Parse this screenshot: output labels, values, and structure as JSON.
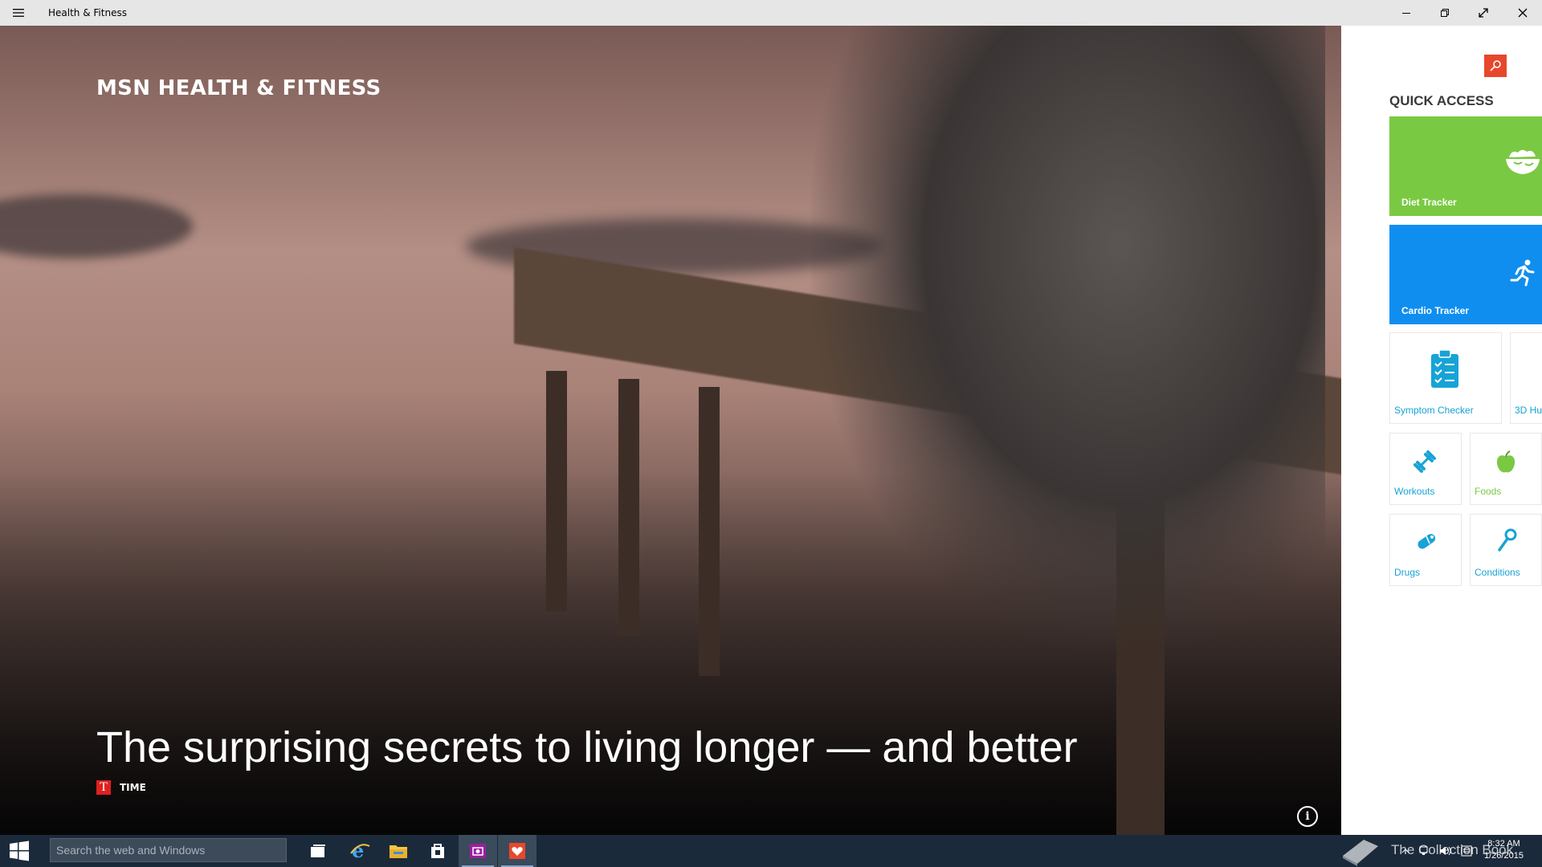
{
  "window": {
    "title": "Health & Fitness"
  },
  "hero": {
    "brand": "MSN HEALTH & FITNESS",
    "headline": "The surprising secrets to living longer — and better",
    "source_logo": "T",
    "source_name": "TIME"
  },
  "panel": {
    "quick_access_title": "QUICK ACCESS",
    "tiles": {
      "diet": {
        "label": "Diet Tracker",
        "color": "#7ac943",
        "icon": "salad-bowl-icon"
      },
      "cardio": {
        "label": "Cardio Tracker",
        "color": "#0f8ef0",
        "icon": "running-person-icon"
      },
      "symptom": {
        "label": "Symptom Checker",
        "icon": "clipboard-checklist-icon"
      },
      "body3d": {
        "label": "3D Hu",
        "icon": ""
      },
      "workouts": {
        "label": "Workouts",
        "icon": "dumbbell-icon"
      },
      "foods": {
        "label": "Foods",
        "icon": "apple-icon"
      },
      "drugs": {
        "label": "Drugs",
        "icon": "pill-icon"
      },
      "conditions": {
        "label": "Conditions",
        "icon": "stethoscope-icon"
      }
    },
    "accent_color": "#e8472b",
    "tile_text_color": "#17a3d6"
  },
  "taskbar": {
    "search_placeholder": "Search the web and Windows",
    "apps": [
      "task-view-icon",
      "internet-explorer-icon",
      "file-explorer-icon",
      "store-icon",
      "photo-app-icon",
      "health-fitness-app-icon"
    ],
    "time": "8:32 AM",
    "date": "1/26/2015"
  },
  "watermark": {
    "text": "The Collection Book"
  }
}
